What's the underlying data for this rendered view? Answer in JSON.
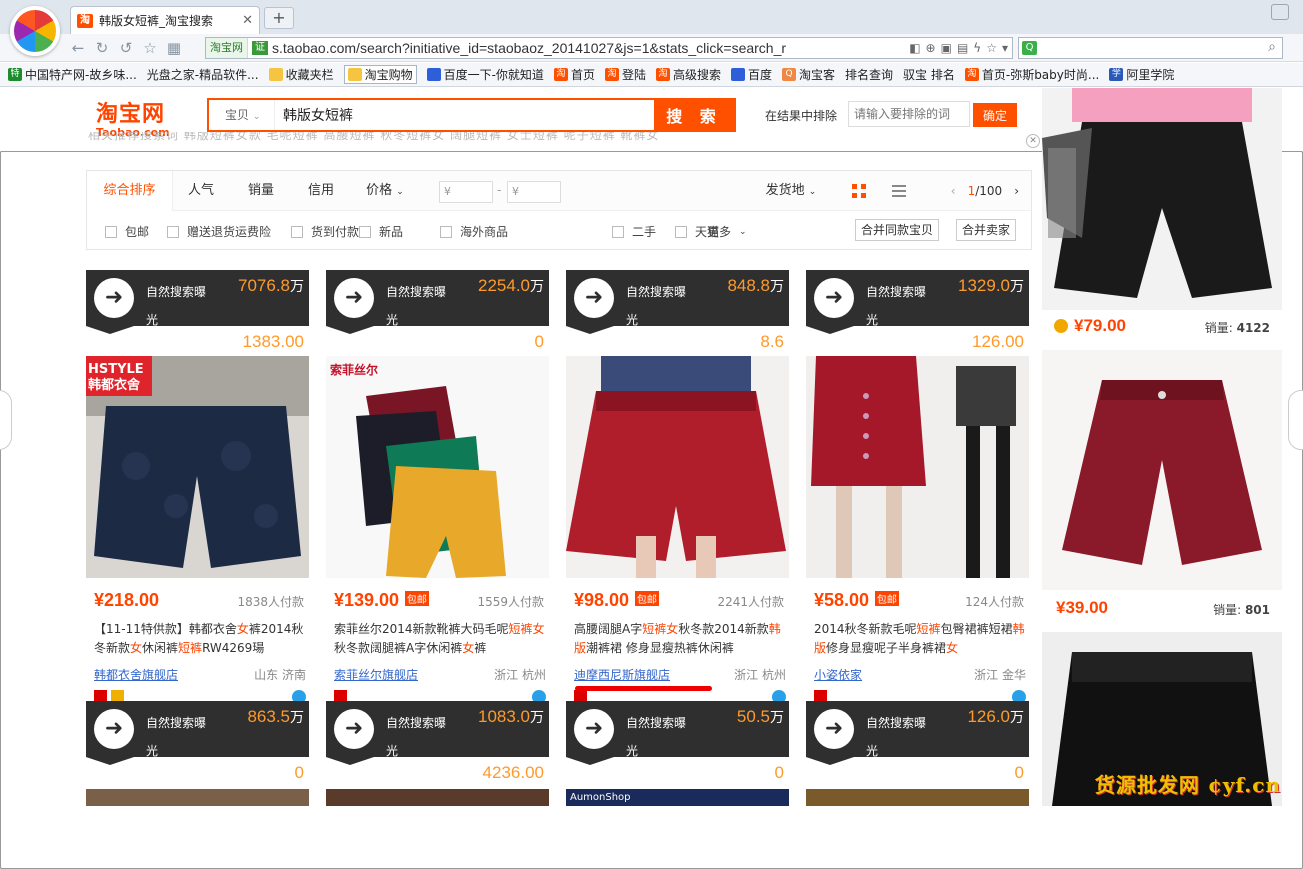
{
  "browser": {
    "tab_title": "韩版女短裤_淘宝搜索",
    "tab_favicon": "淘",
    "url_site": "淘宝网",
    "url_cert": "证",
    "url": "s.taobao.com/search?initiative_id=staobaoz_20141027&js=1&stats_click=search_r",
    "search_engine_icon": "Q"
  },
  "bookmarks": [
    {
      "icon": "特",
      "kind": "green",
      "label": "中国特产网-故乡味..."
    },
    {
      "icon": "",
      "kind": "page",
      "label": "光盘之家-精品软件..."
    },
    {
      "icon": "",
      "kind": "folder",
      "label": "收藏夹栏"
    },
    {
      "icon": "",
      "kind": "folder",
      "label": "淘宝购物"
    },
    {
      "icon": "",
      "kind": "paw",
      "label": "百度一下-你就知道"
    },
    {
      "icon": "淘",
      "kind": "tao",
      "label": "首页"
    },
    {
      "icon": "淘",
      "kind": "tao",
      "label": "登陆"
    },
    {
      "icon": "淘",
      "kind": "tao",
      "label": "高级搜索"
    },
    {
      "icon": "",
      "kind": "paw",
      "label": "百度"
    },
    {
      "icon": "Q",
      "kind": "multi",
      "label": "淘宝客"
    },
    {
      "icon": "",
      "kind": "page",
      "label": "排名查询"
    },
    {
      "icon": "",
      "kind": "page",
      "label": "驭宝 排名"
    },
    {
      "icon": "淘",
      "kind": "tao",
      "label": "首页-弥斯baby时尚..."
    },
    {
      "icon": "学",
      "kind": "blue",
      "label": "阿里学院"
    }
  ],
  "header": {
    "logo_cn": "淘宝网",
    "logo_en": "Taobao.com",
    "search_category": "宝贝",
    "search_value": "韩版女短裤",
    "search_button": "搜 索",
    "refine_label": "在结果中排除",
    "refine_placeholder": "请输入要排除的词",
    "refine_button": "确定"
  },
  "sortbar": {
    "tabs": [
      "综合排序",
      "人气",
      "销量",
      "信用",
      "价格"
    ],
    "price_from": "¥",
    "price_to": "¥",
    "ship_from": "发货地",
    "page_current": "1",
    "page_total": "/100",
    "filters": [
      "包邮",
      "赠送退货运费险",
      "货到付款",
      "新品",
      "海外商品",
      "二手",
      "天猫"
    ],
    "more": "更多",
    "merge_same": "合并同款宝贝",
    "merge_seller": "合并卖家"
  },
  "ad": {
    "label_line1": "自然搜索曝",
    "label_line2": "光",
    "unit": "万"
  },
  "products": [
    {
      "ad_value": "7076.8",
      "ad_sub": "1383.00",
      "brand_tag": "HSTYLE\n韩都衣舍",
      "price": "¥218.00",
      "free_ship": "",
      "buyers": "1838人付款",
      "title_parts": [
        "【11-11特供款】韩都衣舍",
        "女",
        "裤2014秋冬新款",
        "女",
        "休闲裤",
        "短裤",
        "RW4269瑒"
      ],
      "shop": "韩都衣舍旗舰店",
      "location": "山东 济南"
    },
    {
      "ad_value": "2254.0",
      "ad_sub": "0",
      "brand_tag": "索菲丝尔",
      "price": "¥139.00",
      "free_ship": "包邮",
      "buyers": "1559人付款",
      "title_parts": [
        "索菲丝尔2014新款靴裤大码毛呢",
        "短裤女",
        "秋冬款阔腿裤A字休闲裤",
        "女",
        "裤"
      ],
      "shop": "索菲丝尔旗舰店",
      "location": "浙江 杭州"
    },
    {
      "ad_value": "848.8",
      "ad_sub": "8.6",
      "brand_tag": "",
      "price": "¥98.00",
      "free_ship": "包邮",
      "buyers": "2241人付款",
      "title_parts": [
        "高腰阔腿A字",
        "短裤女",
        "秋冬款2014新款",
        "韩版",
        "潮裤裙 修身显瘦热裤休闲裤"
      ],
      "shop": "迪摩西尼斯旗舰店",
      "location": "浙江 杭州"
    },
    {
      "ad_value": "1329.0",
      "ad_sub": "126.00",
      "brand_tag": "",
      "price": "¥58.00",
      "free_ship": "包邮",
      "buyers": "124人付款",
      "title_parts": [
        "2014秋冬新款毛呢",
        "短裤",
        "包臀裙裤短裙",
        "韩版",
        "修身显瘦呢子半身裤裙",
        "女"
      ],
      "shop": "小姿依家",
      "location": "浙江 金华"
    }
  ],
  "products_row2": [
    {
      "ad_value": "863.5",
      "ad_sub": "0"
    },
    {
      "ad_value": "1083.0",
      "ad_sub": "4236.00"
    },
    {
      "ad_value": "50.5",
      "ad_sub": "0",
      "brand_tag": "AumonShop"
    },
    {
      "ad_value": "126.0",
      "ad_sub": "0"
    }
  ],
  "right_column": [
    {
      "price": "¥79.00",
      "sales_label": "销量:",
      "sales": "4122"
    },
    {
      "price": "¥39.00",
      "sales_label": "销量:",
      "sales": "801"
    }
  ],
  "watermark": "货源批发网 ¢yf.cn"
}
